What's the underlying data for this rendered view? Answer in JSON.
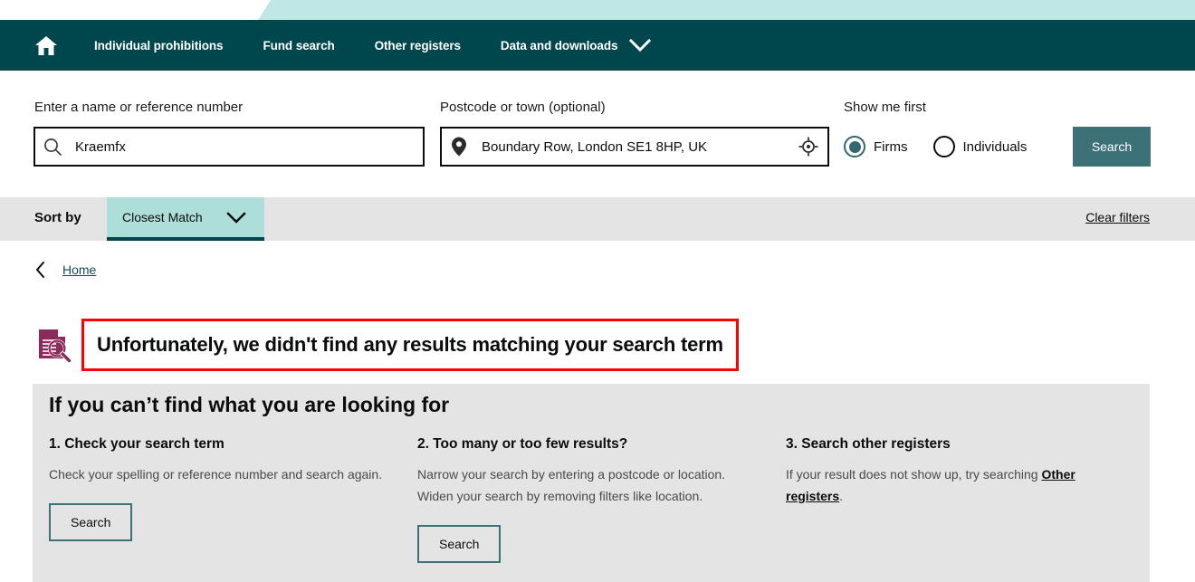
{
  "nav": {
    "home_icon": "home-icon",
    "items": [
      {
        "label": "Individual prohibitions"
      },
      {
        "label": "Fund search"
      },
      {
        "label": "Other registers"
      },
      {
        "label": "Data and downloads"
      }
    ],
    "dropdown_icon": "chevron-down-icon"
  },
  "search": {
    "name_label": "Enter a name or reference number",
    "name_value": "Kraemfx",
    "name_placeholder": "Enter a name or reference number",
    "name_icon": "search-icon",
    "postcode_label": "Postcode or town (optional)",
    "postcode_value": "Boundary Row, London SE1 8HP, UK",
    "postcode_placeholder": "Postcode or town",
    "postcode_icon": "map-pin-icon",
    "locate_icon": "crosshair-locate-icon",
    "show_me_first_label": "Show me first",
    "radios": [
      {
        "label": "Firms",
        "selected": true
      },
      {
        "label": "Individuals",
        "selected": false
      }
    ],
    "search_button": "Search"
  },
  "sortbar": {
    "sort_by_label": "Sort by",
    "selected_sort": "Closest Match",
    "sort_options": [
      "Closest Match"
    ],
    "chevron_icon": "chevron-down-icon",
    "clear_filters": "Clear filters"
  },
  "breadcrumb": {
    "back_icon": "chevron-left-icon",
    "home_label": "Home"
  },
  "no_results": {
    "icon": "document-search-icon",
    "message": "Unfortunately, we didn't find any results matching your search term"
  },
  "help_panel": {
    "title": "If you can’t find what you are looking for",
    "columns": [
      {
        "title": "1. Check your search term",
        "body": "Check your spelling or reference number and search again.",
        "button": "Search"
      },
      {
        "title": "2. Too many or too few results?",
        "body_line1": "Narrow your search by entering a postcode or location.",
        "body_line2": "Widen your search by removing filters like location.",
        "button": "Search"
      },
      {
        "title": "3. Search other registers",
        "body_prefix": "If your result does not show up, try searching ",
        "link": "Other registers",
        "body_suffix": "."
      }
    ]
  },
  "colors": {
    "nav_bg": "#00474d",
    "top_accent": "#bfe7e5",
    "teal_button": "#3d7178",
    "sort_chip": "#aeded9",
    "panel_bg": "#e4e4e4",
    "error_border": "#ff0000",
    "icon_maroon": "#8a2b5a"
  }
}
